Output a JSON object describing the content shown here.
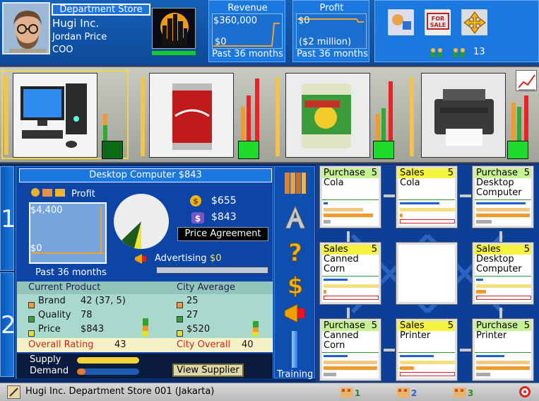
{
  "company": {
    "department_label": "Department Store",
    "name": "Hugi Inc.",
    "person_name": "Jordan Price",
    "person_role": "COO"
  },
  "revenue": {
    "title": "Revenue",
    "value": "$360,000",
    "zero": "$0",
    "period": "Past 36 months"
  },
  "profit": {
    "title": "Profit",
    "zero": "$0",
    "value": "($2 million)",
    "period": "Past 36 months"
  },
  "tools": {
    "count": "13"
  },
  "products": [
    {
      "name": "Desktop Computer",
      "icon": "desktop-computer-icon"
    },
    {
      "name": "Cola",
      "icon": "cola-can-icon"
    },
    {
      "name": "Canned Corn",
      "icon": "canned-corn-icon"
    },
    {
      "name": "Printer",
      "icon": "printer-icon"
    }
  ],
  "detail": {
    "title": "Desktop Computer  $843",
    "profit_label": "Profit",
    "graph_top": "$4,400",
    "graph_zero": "$0",
    "graph_period": "Past 36 months",
    "cost_value": "$655",
    "price_value": "$843",
    "price_button": "Price Agreement",
    "advertising_label": "Advertising",
    "advertising_value": "$0",
    "current_product_header": "Current Product",
    "city_average_header": "City Average",
    "rows": [
      {
        "label": "Brand",
        "value": "42 (37, 5)",
        "city": "25",
        "color": "#f29a2e"
      },
      {
        "label": "Quality",
        "value": "78",
        "city": "27",
        "color": "#2fa52f"
      },
      {
        "label": "Price",
        "value": "$843",
        "city": "$520",
        "color": "#e3e32a"
      }
    ],
    "overall_label": "Overall Rating",
    "overall_value": "43",
    "city_overall_label": "City Overall",
    "city_overall_value": "40",
    "supply_label": "Supply",
    "demand_label": "Demand",
    "view_supplier_button": "View Supplier"
  },
  "side_menu": {
    "training_label": "Training"
  },
  "units": [
    {
      "type": "Purchase",
      "num": "5",
      "item": "Cola"
    },
    {
      "type": "Sales",
      "num": "5",
      "item": "Cola"
    },
    {
      "type": "Purchase",
      "num": "5",
      "item": "Desktop Computer"
    },
    {
      "type": "Sales",
      "num": "5",
      "item": "Canned Corn"
    },
    {
      "type": "",
      "num": "",
      "item": ""
    },
    {
      "type": "Sales",
      "num": "5",
      "item": "Desktop Computer"
    },
    {
      "type": "Purchase",
      "num": "5",
      "item": "Canned Corn"
    },
    {
      "type": "Sales",
      "num": "5",
      "item": "Printer"
    },
    {
      "type": "Purchase",
      "num": "5",
      "item": "Printer"
    }
  ],
  "footer": {
    "status": "Hugi Inc. Department Store 001 (Jakarta)"
  },
  "tabs": [
    "1",
    "2"
  ]
}
